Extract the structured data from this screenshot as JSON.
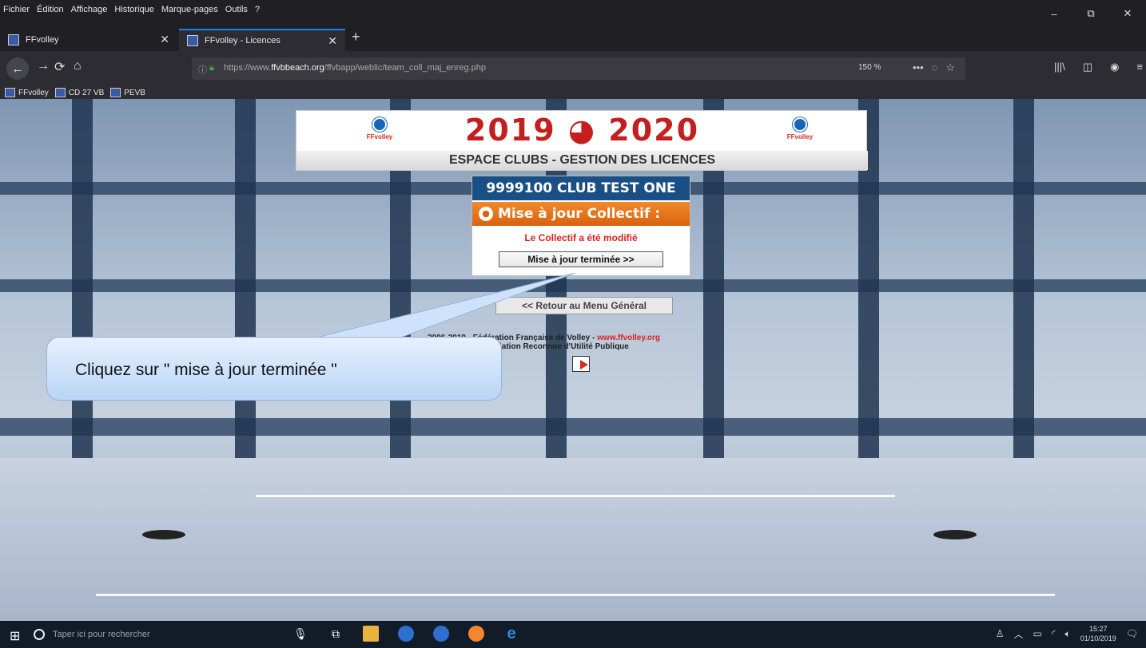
{
  "menubar": {
    "items": [
      "Fichier",
      "Édition",
      "Affichage",
      "Historique",
      "Marque-pages",
      "Outils",
      "?"
    ],
    "minimize": "–",
    "restore": "⧉",
    "close": "✕"
  },
  "tabs": [
    {
      "label": "FFvolley",
      "close": "✕"
    },
    {
      "label": "FFvolley - Licences",
      "close": "✕"
    }
  ],
  "new_tab": "+",
  "nav": {
    "back": "←",
    "forward": "→",
    "reload": "⟳",
    "home": "⌂",
    "url_prefix": "https://www.",
    "url_domain": "ffvbbeach.org",
    "url_path": "/ffvbapp/weblic/team_coll_maj_enreg.php",
    "zoom": "150 %",
    "more": "•••",
    "pocket": "◌",
    "star": "☆"
  },
  "bookmarks": [
    "FFvolley",
    "CD 27 VB",
    "PEVB"
  ],
  "page": {
    "season": "2019 ◕ 2020",
    "logo_text": "FFvolley",
    "subtitle": "ESPACE CLUBS - GESTION DES LICENCES",
    "club": "9999100 CLUB TEST ONE",
    "section_title": "Mise à jour Collectif :",
    "status_message": "Le Collectif a été modifié",
    "done_button": "Mise à jour terminée >>",
    "back_button": "<< Retour au Menu Général",
    "copyright_line1": "2006-2019 - Fédération Française de Volley -",
    "copyright_link": "www.ffvolley.org",
    "copyright_line2": "Association Reconnue d'Utilité Publique"
  },
  "callout": {
    "text": "Cliquez sur \" mise à jour terminée \""
  },
  "taskbar": {
    "search_placeholder": "Taper ici pour rechercher",
    "time": "15:27",
    "date": "01/10/2019"
  }
}
